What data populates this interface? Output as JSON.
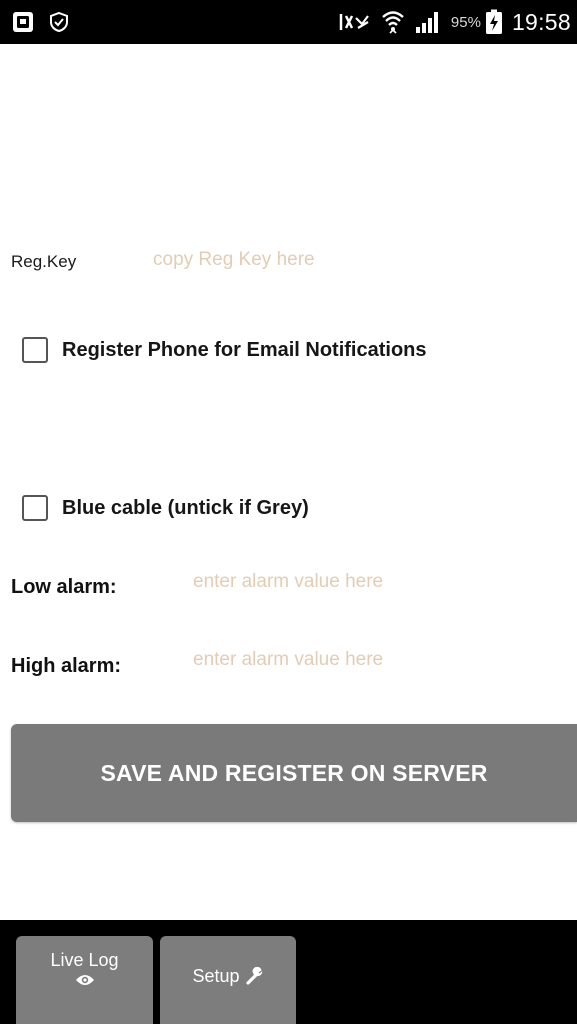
{
  "status_bar": {
    "left_icons": [
      "pocket-icon",
      "shield-check-icon"
    ],
    "right_icons": [
      "nfc-icon",
      "wifi-icon",
      "signal-icon",
      "battery-charging-icon"
    ],
    "battery": "95%",
    "time": "19:58"
  },
  "form": {
    "reg_key": {
      "label": "Reg.Key",
      "value": "",
      "placeholder": "copy Reg Key here"
    },
    "register_phone": {
      "label": "Register Phone for Email Notifications",
      "checked": false
    },
    "blue_cable": {
      "label": "Blue cable (untick if Grey)",
      "checked": false
    },
    "low_alarm": {
      "label": "Low alarm:",
      "value": "",
      "placeholder": "enter alarm value here"
    },
    "high_alarm": {
      "label": "High alarm:",
      "value": "",
      "placeholder": "enter alarm value here"
    },
    "save_button": "SAVE AND REGISTER ON SERVER"
  },
  "bottom_nav": {
    "live_log": {
      "label": "Live Log",
      "icon": "eye-icon"
    },
    "setup": {
      "label": "Setup",
      "icon": "wrench-icon"
    }
  },
  "colors": {
    "placeholder": "#e3ccb4",
    "button": "#7a7a7a",
    "tab": "#7d7d7d",
    "bar": "#000000"
  }
}
